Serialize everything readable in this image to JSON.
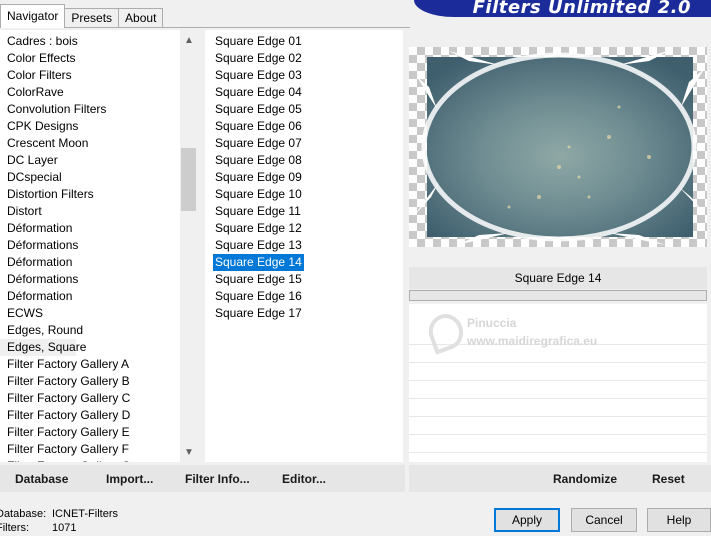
{
  "tabs": [
    "Navigator",
    "Presets",
    "About"
  ],
  "banner_title": "Filters Unlimited 2.0",
  "categories": [
    "Cadres : bois",
    "Color Effects",
    "Color Filters",
    "ColorRave",
    "Convolution Filters",
    "CPK Designs",
    "Crescent Moon",
    "DC Layer",
    "DCspecial",
    "Distortion Filters",
    "Distort",
    "Déformation",
    "Déformations",
    "Déformation",
    "Déformations",
    "Déformation",
    "ECWS",
    "Edges, Round",
    "Edges, Square",
    "Filter Factory Gallery A",
    "Filter Factory Gallery B",
    "Filter Factory Gallery C",
    "Filter Factory Gallery D",
    "Filter Factory Gallery E",
    "Filter Factory Gallery F",
    "Filter Factory Gallery G"
  ],
  "selected_category_index": 18,
  "filters": [
    "Square Edge 01",
    "Square Edge 02",
    "Square Edge 03",
    "Square Edge 04",
    "Square Edge 05",
    "Square Edge 06",
    "Square Edge 07",
    "Square Edge 08",
    "Square Edge 09",
    "Square Edge 10",
    "Square Edge 11",
    "Square Edge 12",
    "Square Edge 13",
    "Square Edge 14",
    "Square Edge 15",
    "Square Edge 16",
    "Square Edge 17"
  ],
  "selected_filter_index": 13,
  "current_filter_name": "Square Edge 14",
  "watermark": {
    "name": "Pinuccia",
    "url": "www.maidiregrafica.eu"
  },
  "left_buttons": {
    "database": "Database",
    "import": "Import...",
    "filter_info": "Filter Info...",
    "editor": "Editor..."
  },
  "right_buttons": {
    "randomize": "Randomize",
    "reset": "Reset"
  },
  "status": {
    "database_label": "Database:",
    "database_value": "ICNET-Filters",
    "filters_label": "Filters:",
    "filters_value": "1071"
  },
  "dialog_buttons": {
    "apply": "Apply",
    "cancel": "Cancel",
    "help": "Help"
  },
  "colors": {
    "banner": "#1b2c9a",
    "selection": "#0078d7"
  }
}
